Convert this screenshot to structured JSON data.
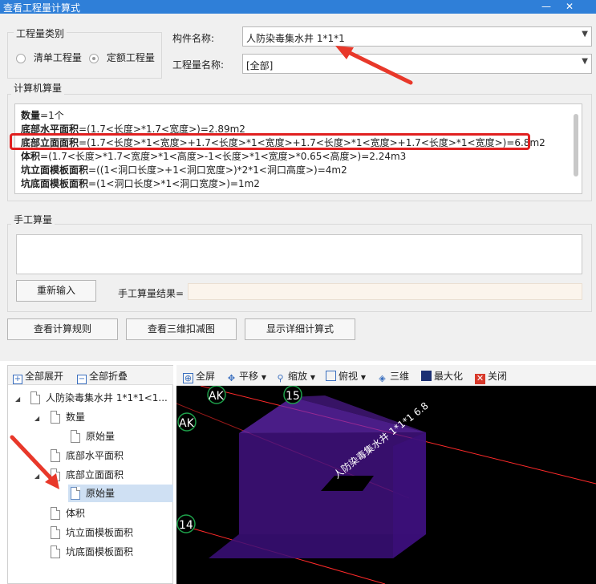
{
  "window": {
    "title": "查看工程量计算式",
    "minimize": "—",
    "close": "✕"
  },
  "quantity_type": {
    "legend": "工程量类别",
    "options": [
      {
        "label": "清单工程量",
        "checked": false
      },
      {
        "label": "定额工程量",
        "checked": true
      }
    ]
  },
  "component": {
    "label": "构件名称:",
    "value": "人防染毒集水井 1*1*1"
  },
  "quantity_name": {
    "label": "工程量名称:",
    "value": "[全部]"
  },
  "computer_calc": {
    "legend": "计算机算量",
    "lines": [
      {
        "name": "数量",
        "formula": "=1个"
      },
      {
        "name": "底部水平面积",
        "formula": "=(1.7<长度>*1.7<宽度>)=2.89m2"
      },
      {
        "name": "底部立面面积",
        "formula": "=(1.7<长度>*1<宽度>+1.7<长度>*1<宽度>+1.7<长度>*1<宽度>+1.7<长度>*1<宽度>)=6.8m2"
      },
      {
        "name": "体积",
        "formula": "=(1.7<长度>*1.7<宽度>*1<高度>-1<长度>*1<宽度>*0.65<高度>)=2.24m3"
      },
      {
        "name": "坑立面模板面积",
        "formula": "=((1<洞口长度>+1<洞口宽度>)*2*1<洞口高度>)=4m2"
      },
      {
        "name": "坑底面模板面积",
        "formula": "=(1<洞口长度>*1<洞口宽度>)=1m2"
      }
    ]
  },
  "manual_calc": {
    "legend": "手工算量",
    "reenter_button": "重新输入",
    "result_label": "手工算量结果="
  },
  "buttons": {
    "view_rules": "查看计算规则",
    "view_3d": "查看三维扣减图",
    "show_detail": "显示详细计算式"
  },
  "tree_toolbar": {
    "expand_all": "全部展开",
    "collapse_all": "全部折叠"
  },
  "tree": [
    {
      "label": "人防染毒集水井 1*1*1<1..."
    },
    {
      "label": "数量"
    },
    {
      "label": "原始量"
    },
    {
      "label": "底部水平面积"
    },
    {
      "label": "底部立面面积"
    },
    {
      "label": "原始量"
    },
    {
      "label": "体积"
    },
    {
      "label": "坑立面模板面积"
    },
    {
      "label": "坑底面模板面积"
    }
  ],
  "view_toolbar": {
    "fullscreen": "全屏",
    "pan": "平移",
    "zoom": "缩放",
    "top_view": "俯视",
    "three_d": "三维",
    "maximize": "最大化",
    "close": "关闭"
  },
  "viewport": {
    "axis_labels": {
      "ak_top": "AK",
      "ak_left": "AK",
      "n15": "15",
      "n14": "14"
    },
    "object_label": "人防染毒集水井 1*1*1 6.8",
    "colors": {
      "object": "#5b1fa8",
      "grid_line": "#ff2a2a",
      "background": "#000000"
    }
  },
  "colors": {
    "titlebar": "#2f7fd8",
    "highlight": "#e02020",
    "arrow": "#e8382a"
  }
}
